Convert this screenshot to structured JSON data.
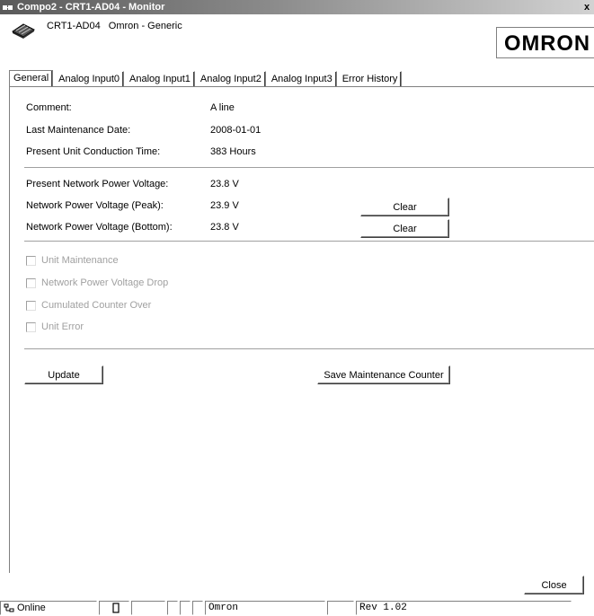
{
  "window": {
    "title": "Compo2 - CRT1-AD04 - Monitor",
    "close_glyph": "x"
  },
  "header": {
    "model": "CRT1-AD04",
    "vendor": "Omron - Generic",
    "logo_text": "OMRON"
  },
  "tabs": [
    {
      "label": "General",
      "active": true
    },
    {
      "label": "Analog Input0"
    },
    {
      "label": "Analog Input1"
    },
    {
      "label": "Analog Input2"
    },
    {
      "label": "Analog Input3"
    },
    {
      "label": "Error History"
    }
  ],
  "general": {
    "comment_label": "Comment:",
    "comment_value": "A line",
    "last_maint_label": "Last Maintenance Date:",
    "last_maint_value": "2008-01-01",
    "conduction_label": "Present Unit Conduction Time:",
    "conduction_value": "383 Hours",
    "net_voltage_label": "Present Network Power Voltage:",
    "net_voltage_value": "23.8 V",
    "peak_label": "Network Power Voltage (Peak):",
    "peak_value": "23.9 V",
    "bottom_label": "Network Power Voltage (Bottom):",
    "bottom_value": "23.8 V",
    "clear_label": "Clear",
    "checkboxes": [
      {
        "label": "Unit Maintenance",
        "checked": false
      },
      {
        "label": "Network Power Voltage Drop",
        "checked": false
      },
      {
        "label": "Cumulated Counter Over",
        "checked": false
      },
      {
        "label": "Unit Error",
        "checked": false
      }
    ],
    "update_label": "Update",
    "save_counter_label": "Save Maintenance Counter"
  },
  "footer": {
    "close_label": "Close"
  },
  "statusbar": {
    "online": "Online",
    "vendor": "Omron",
    "rev": "Rev 1.02"
  }
}
